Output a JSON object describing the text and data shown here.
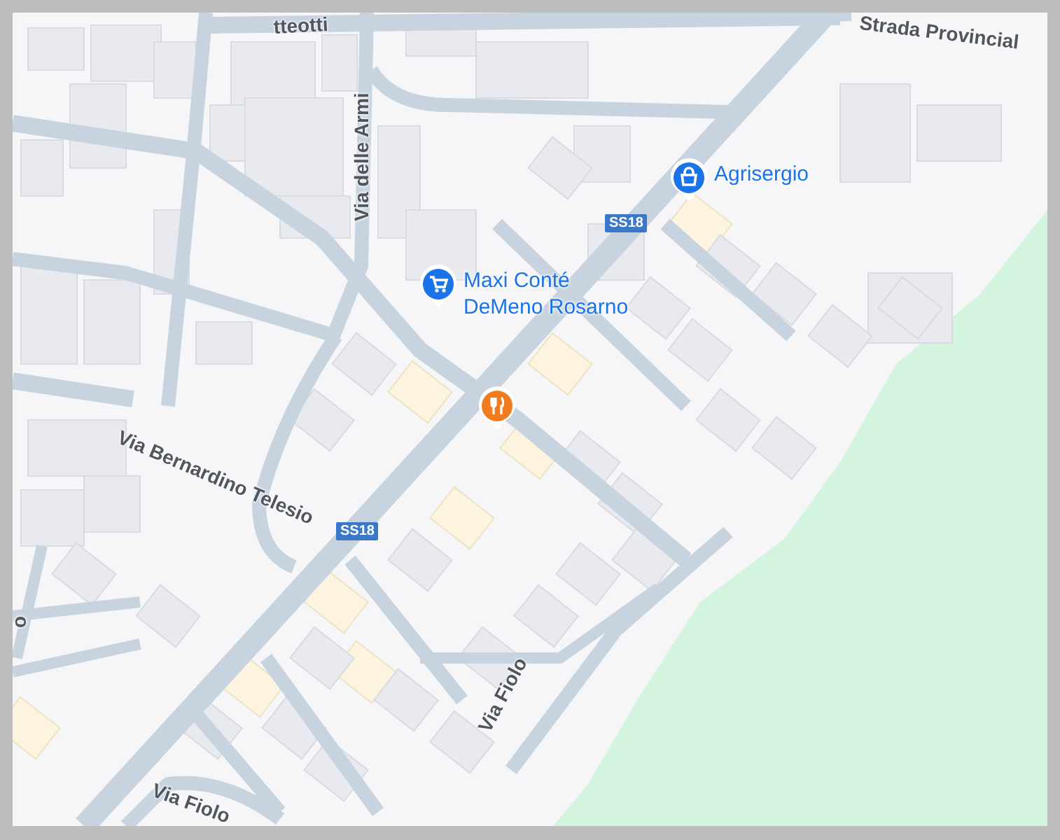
{
  "map": {
    "streets": [
      {
        "name": "tteotti"
      },
      {
        "name": "Strada Provincial"
      },
      {
        "name": "Via delle Armi"
      },
      {
        "name": "Via Bernardino Telesio"
      },
      {
        "name": "Via Fiolo"
      },
      {
        "name": "Via Fiolo"
      },
      {
        "name": "o"
      }
    ],
    "shields": [
      {
        "label": "SS18"
      },
      {
        "label": "SS18"
      }
    ],
    "places": [
      {
        "kind": "shop",
        "lines": [
          "Agrisergio"
        ]
      },
      {
        "kind": "grocery",
        "lines": [
          "Maxi Conté",
          "DeMeno Rosarno"
        ]
      },
      {
        "kind": "restaurant"
      }
    ]
  }
}
